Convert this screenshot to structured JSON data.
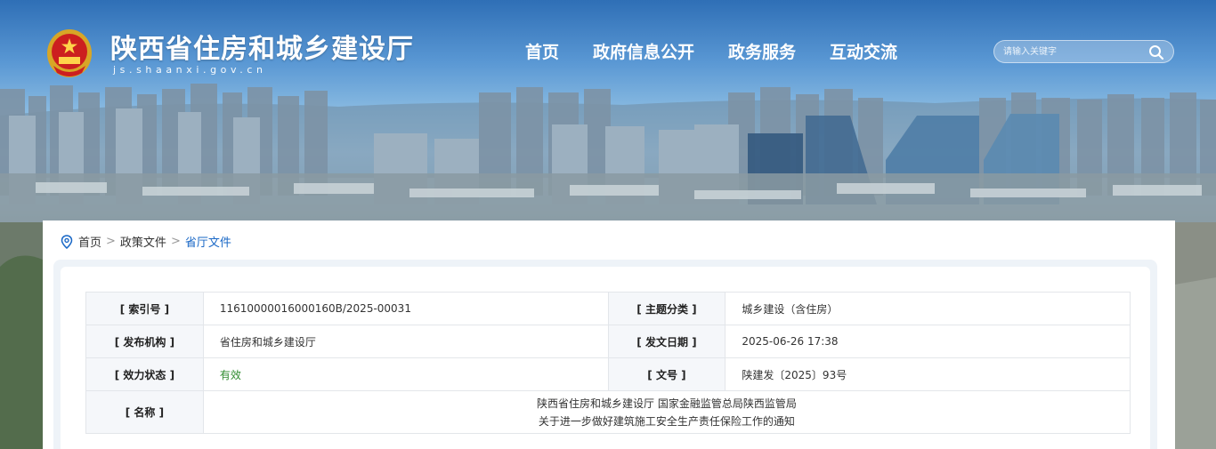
{
  "header": {
    "site_title": "陕西省住房和城乡建设厅",
    "site_domain": "js.shaanxi.gov.cn",
    "nav": [
      "首页",
      "政府信息公开",
      "政务服务",
      "互动交流"
    ],
    "search_placeholder": "请输入关键字"
  },
  "breadcrumb": {
    "items": [
      "首页",
      "政策文件",
      "省厅文件"
    ],
    "separator": ">"
  },
  "meta": {
    "index_label": "[ 索引号 ]",
    "index_value": "11610000016000160B/2025-00031",
    "topic_label": "[ 主题分类 ]",
    "topic_value": "城乡建设（含住房）",
    "publisher_label": "[ 发布机构 ]",
    "publisher_value": "省住房和城乡建设厅",
    "date_label": "[ 发文日期 ]",
    "date_value": "2025-06-26 17:38",
    "status_label": "[ 效力状态 ]",
    "status_value": "有效",
    "docno_label": "[ 文号 ]",
    "docno_value": "陕建发〔2025〕93号",
    "name_label": "[ 名称 ]",
    "name_line1": "陕西省住房和城乡建设厅 国家金融监管总局陕西监管局",
    "name_line2": "关于进一步做好建筑施工安全生产责任保险工作的通知"
  },
  "colors": {
    "accent": "#1a68c6",
    "status_green": "#2e8b2e",
    "label_bg": "#f5f7fa"
  }
}
